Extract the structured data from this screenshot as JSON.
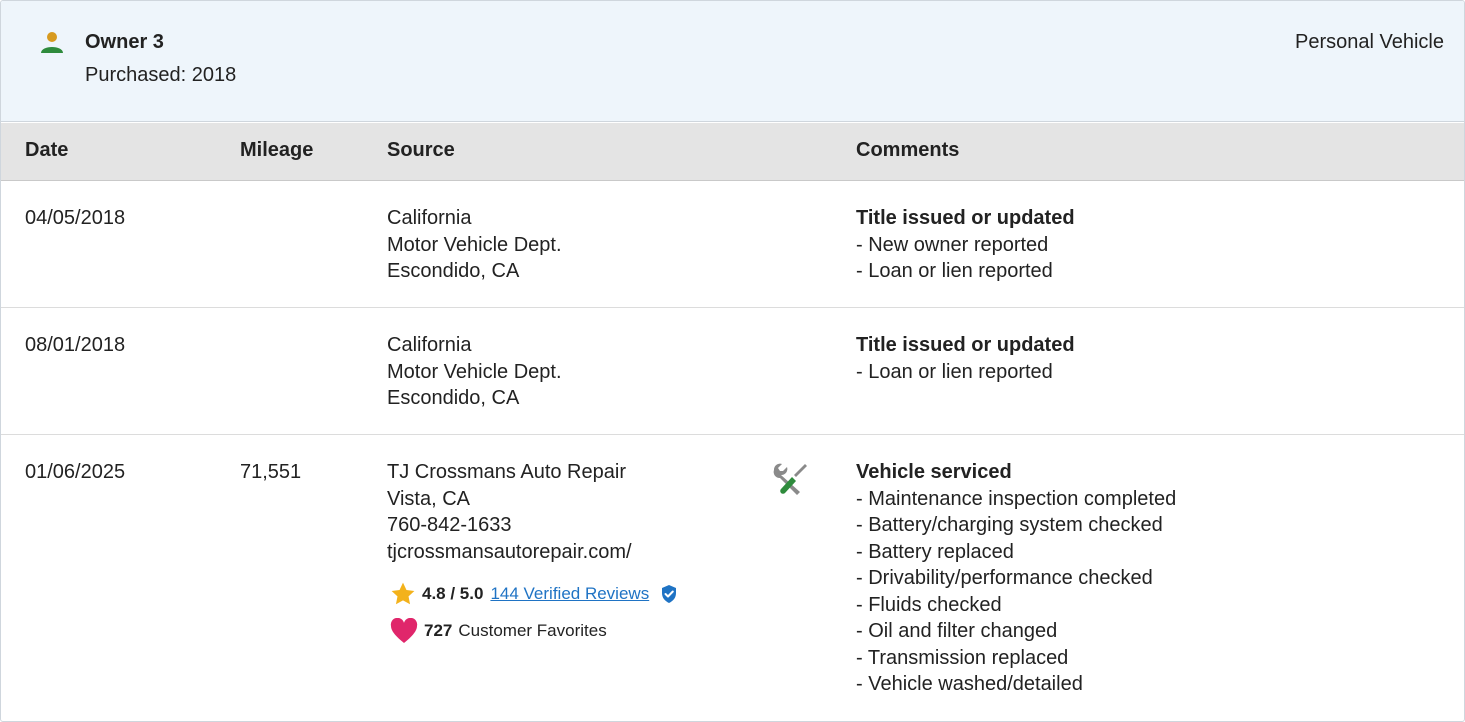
{
  "owner": {
    "title": "Owner 3",
    "purchased": "Purchased: 2018",
    "type": "Personal Vehicle",
    "icon": "person-icon",
    "icon_colors": {
      "head": "#d79a1f",
      "body": "#2e8b3c"
    }
  },
  "table": {
    "headers": {
      "date": "Date",
      "mileage": "Mileage",
      "source": "Source",
      "comments": "Comments"
    },
    "rows": [
      {
        "date": "04/05/2018",
        "mileage": "",
        "source": [
          "California",
          "Motor Vehicle Dept.",
          "Escondido, CA"
        ],
        "comment_title": "Title issued or updated",
        "comments": [
          "New owner reported",
          "Loan or lien reported"
        ]
      },
      {
        "date": "08/01/2018",
        "mileage": "",
        "source": [
          "California",
          "Motor Vehicle Dept.",
          "Escondido, CA"
        ],
        "comment_title": "Title issued or updated",
        "comments": [
          "Loan or lien reported"
        ]
      },
      {
        "date": "01/06/2025",
        "mileage": "71,551",
        "source": [
          "TJ Crossmans Auto Repair",
          "Vista, CA",
          "760-842-1633",
          "tjcrossmansautorepair.com/"
        ],
        "rating": {
          "score": "4.8 / 5.0",
          "reviews_link": "144 Verified Reviews"
        },
        "favorites": {
          "count": "727",
          "label": "Customer Favorites"
        },
        "source_icon": "wrench-screwdriver-icon",
        "comment_title": "Vehicle serviced",
        "comments": [
          "Maintenance inspection completed",
          "Battery/charging system checked",
          "Battery replaced",
          "Drivability/performance checked",
          "Fluids checked",
          "Oil and filter changed",
          "Transmission replaced",
          "Vehicle washed/detailed"
        ]
      }
    ]
  },
  "colors": {
    "header_bg": "#eef5fb",
    "table_head_bg": "#e4e4e4",
    "link": "#1f73c4",
    "star": "#f3b21b",
    "heart": "#e0266b",
    "verified_badge": "#1f73c4",
    "tool_gray": "#8a8a8a",
    "tool_green": "#2e8b3c"
  }
}
